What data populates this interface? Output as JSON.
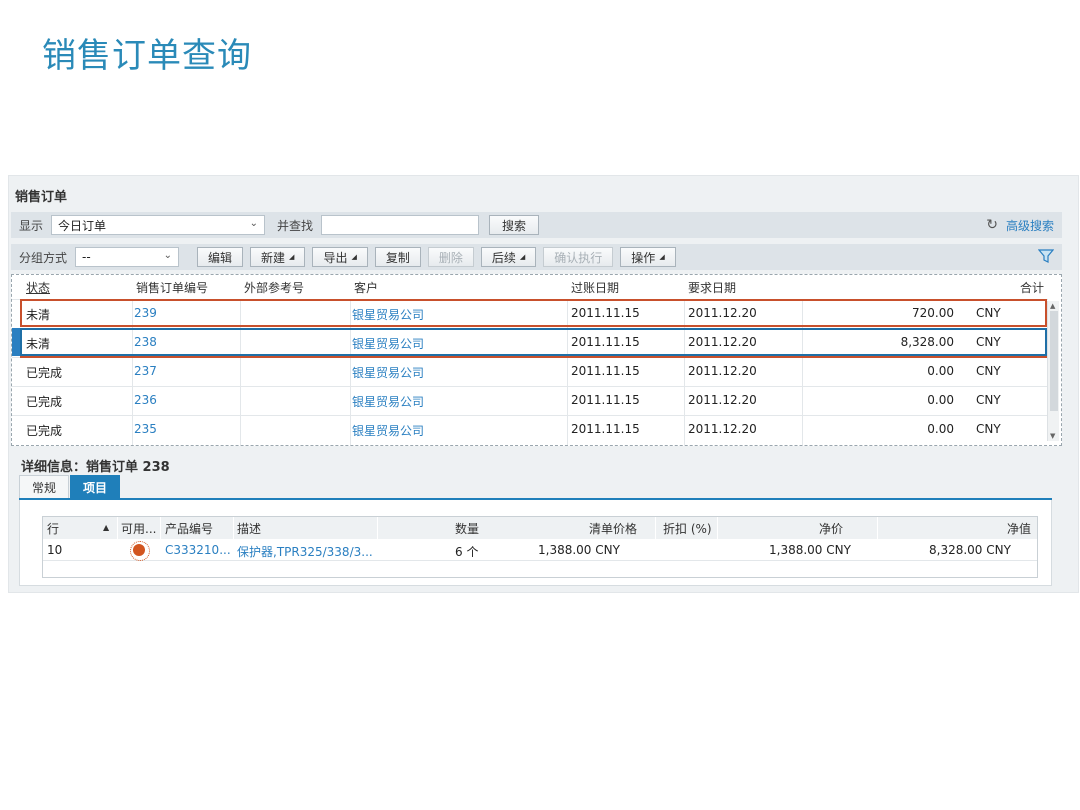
{
  "slide_title": "销售订单查询",
  "app": {
    "title": "销售订单",
    "toolbar1": {
      "show_label": "显示",
      "show_value": "今日订单",
      "find_label": "并查找",
      "find_value": "",
      "search_button": "搜索",
      "advanced_search": "高级搜索"
    },
    "toolbar2": {
      "group_label": "分组方式",
      "group_value": "--",
      "edit": "编辑",
      "new": "新建",
      "export": "导出",
      "copy": "复制",
      "delete": "删除",
      "followup": "后续",
      "confirm": "确认执行",
      "actions": "操作"
    },
    "grid": {
      "headers": {
        "status": "状态",
        "order_no": "销售订单编号",
        "ext_ref": "外部参考号",
        "customer": "客户",
        "posting_date": "过账日期",
        "req_date": "要求日期",
        "total": "合计"
      },
      "rows": [
        {
          "status": "未清",
          "order_no": "239",
          "ext_ref": "",
          "customer": "银星贸易公司",
          "posting_date": "2011.11.15",
          "req_date": "2011.12.20",
          "amount": "720.00",
          "currency": "CNY"
        },
        {
          "status": "未清",
          "order_no": "238",
          "ext_ref": "",
          "customer": "银星贸易公司",
          "posting_date": "2011.11.15",
          "req_date": "2011.12.20",
          "amount": "8,328.00",
          "currency": "CNY"
        },
        {
          "status": "已完成",
          "order_no": "237",
          "ext_ref": "",
          "customer": "银星贸易公司",
          "posting_date": "2011.11.15",
          "req_date": "2011.12.20",
          "amount": "0.00",
          "currency": "CNY"
        },
        {
          "status": "已完成",
          "order_no": "236",
          "ext_ref": "",
          "customer": "银星贸易公司",
          "posting_date": "2011.11.15",
          "req_date": "2011.12.20",
          "amount": "0.00",
          "currency": "CNY"
        },
        {
          "status": "已完成",
          "order_no": "235",
          "ext_ref": "",
          "customer": "银星贸易公司",
          "posting_date": "2011.11.15",
          "req_date": "2011.12.20",
          "amount": "0.00",
          "currency": "CNY"
        }
      ]
    },
    "detail": {
      "title": "详细信息：销售订单 238",
      "tabs": [
        "常规",
        "项目"
      ],
      "active_tab": "项目",
      "items_headers": {
        "line": "行",
        "avail": "可用...",
        "product_no": "产品编号",
        "desc": "描述",
        "qty": "数量",
        "list_price": "清单价格",
        "discount": "折扣 (%)",
        "net_price": "净价",
        "net_value": "净值"
      },
      "items": [
        {
          "line": "10",
          "product_no": "C333210...",
          "desc": "保护器,TPR325/338/3...",
          "qty": "6 个",
          "list_price": "1,388.00 CNY",
          "discount": "",
          "net_price": "1,388.00 CNY",
          "net_value": "8,328.00 CNY"
        }
      ]
    }
  }
}
